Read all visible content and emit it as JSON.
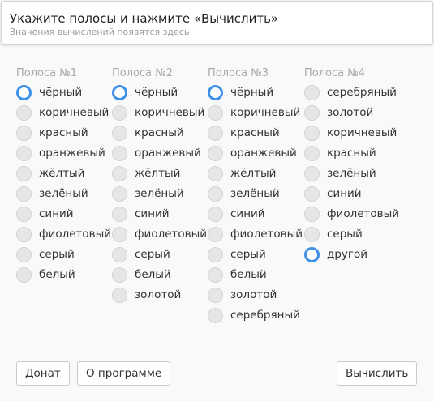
{
  "header": {
    "title": "Укажите полосы и нажмите «Вычислить»",
    "subtitle": "Значения вычислений появятся здесь"
  },
  "columns": [
    {
      "title": "Полоса №1",
      "selected": 0,
      "options": [
        "чёрный",
        "коричневый",
        "красный",
        "оранжевый",
        "жёлтый",
        "зелёный",
        "синий",
        "фиолетовый",
        "серый",
        "белый"
      ]
    },
    {
      "title": "Полоса №2",
      "selected": 0,
      "options": [
        "чёрный",
        "коричневый",
        "красный",
        "оранжевый",
        "жёлтый",
        "зелёный",
        "синий",
        "фиолетовый",
        "серый",
        "белый",
        "золотой"
      ]
    },
    {
      "title": "Полоса №3",
      "selected": 0,
      "options": [
        "чёрный",
        "коричневый",
        "красный",
        "оранжевый",
        "жёлтый",
        "зелёный",
        "синий",
        "фиолетовый",
        "серый",
        "белый",
        "золотой",
        "серебряный"
      ]
    },
    {
      "title": "Полоса №4",
      "selected": 8,
      "options": [
        "серебряный",
        "золотой",
        "коричневый",
        "красный",
        "зелёный",
        "синий",
        "фиолетовый",
        "серый",
        "другой"
      ]
    }
  ],
  "buttons": {
    "donate": "Донат",
    "about": "О программе",
    "calculate": "Вычислить"
  },
  "colors": {
    "accent": "#3d8fe8",
    "radio_unchecked": "#e6e6e6",
    "background": "#f9f9f9"
  }
}
